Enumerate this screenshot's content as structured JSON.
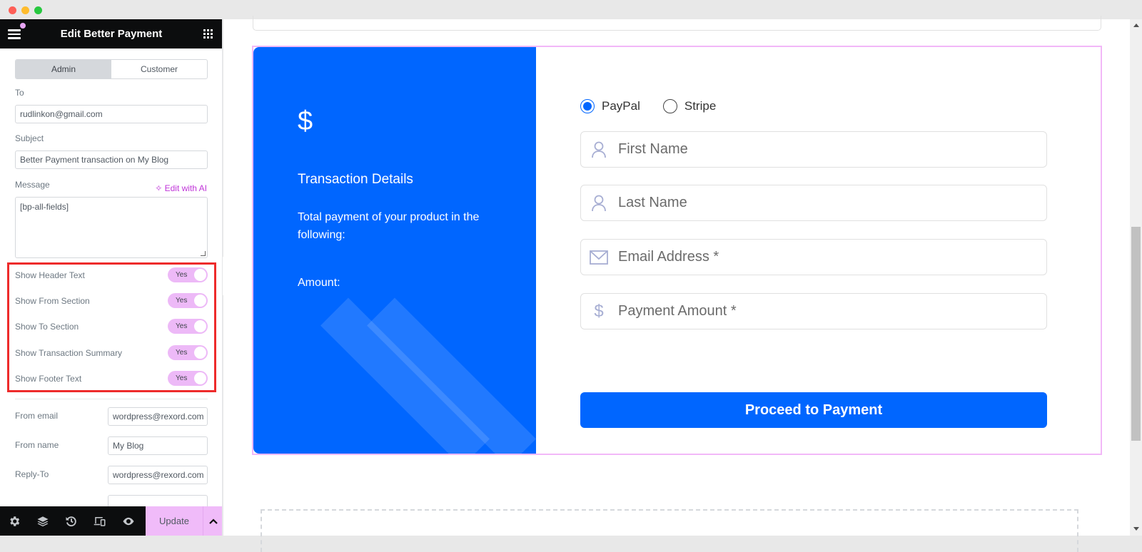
{
  "sidebar": {
    "title": "Edit Better Payment",
    "tabs": [
      {
        "label": "Admin",
        "active": true
      },
      {
        "label": "Customer",
        "active": false
      }
    ],
    "fields": {
      "to_label": "To",
      "to_value": "rudlinkon@gmail.com",
      "subject_label": "Subject",
      "subject_value": "Better Payment transaction on My Blog",
      "message_label": "Message",
      "edit_with_ai": "Edit with AI",
      "message_value": "[bp-all-fields]"
    },
    "switches": [
      {
        "label": "Show Header Text",
        "state": "Yes"
      },
      {
        "label": "Show From Section",
        "state": "Yes"
      },
      {
        "label": "Show To Section",
        "state": "Yes"
      },
      {
        "label": "Show Transaction Summary",
        "state": "Yes"
      },
      {
        "label": "Show Footer Text",
        "state": "Yes"
      }
    ],
    "sender": {
      "from_email_label": "From email",
      "from_email_value": "wordpress@rexord.com",
      "from_name_label": "From name",
      "from_name_value": "My Blog",
      "reply_to_label": "Reply-To",
      "reply_to_value": "wordpress@rexord.com"
    },
    "footer": {
      "icons": [
        "settings-icon",
        "layers-icon",
        "history-icon",
        "responsive-icon",
        "preview-icon"
      ],
      "update_label": "Update"
    }
  },
  "payment_widget": {
    "currency_symbol": "$",
    "title": "Transaction Details",
    "description": "Total payment of your product in the following:",
    "amount_label": "Amount:",
    "methods": [
      {
        "label": "PayPal",
        "checked": true
      },
      {
        "label": "Stripe",
        "checked": false
      }
    ],
    "fields": [
      {
        "icon": "user-icon",
        "placeholder": "First Name"
      },
      {
        "icon": "user-icon",
        "placeholder": "Last Name"
      },
      {
        "icon": "envelope-icon",
        "placeholder": "Email Address *"
      },
      {
        "icon": "dollar-icon",
        "placeholder": "Payment Amount *"
      }
    ],
    "submit_label": "Proceed to Payment"
  },
  "colors": {
    "primary_blue": "#0066ff",
    "editor_accent": "#f0bbf9",
    "highlight_red": "#ee2b2b",
    "ai_link": "#c036d9"
  }
}
